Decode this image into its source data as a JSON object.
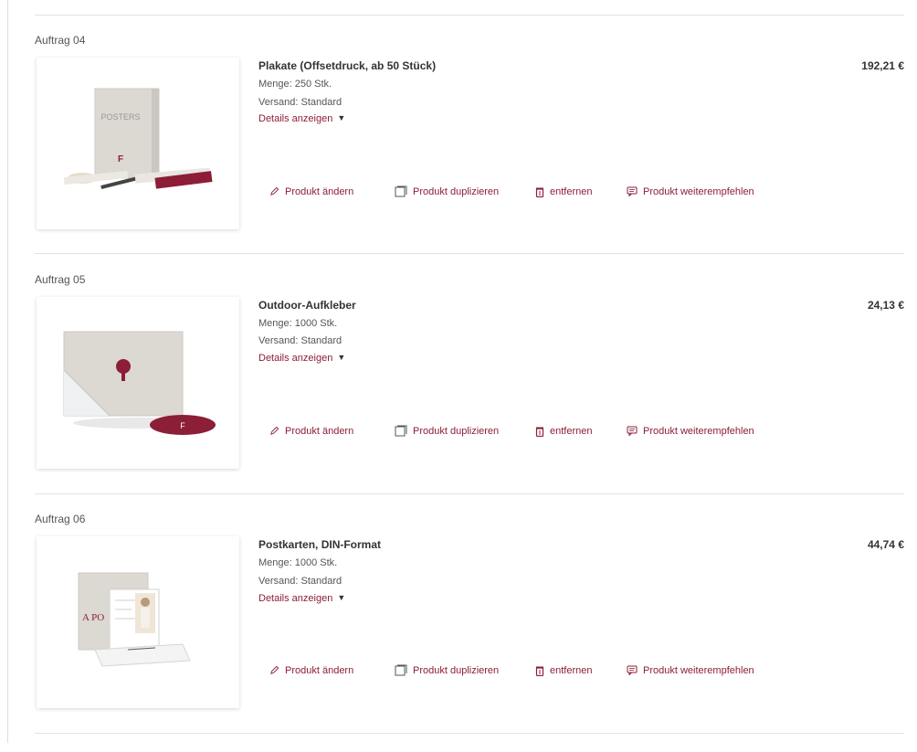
{
  "orders": [
    {
      "label": "Auftrag 04",
      "title": "Plakate (Offsetdruck, ab 50 Stück)",
      "quantity": "Menge: 250 Stk.",
      "shipping": "Versand: Standard",
      "details": "Details anzeigen",
      "price": "192,21 €",
      "image_text": "POSTERS",
      "image_icon": "poster-product-icon"
    },
    {
      "label": "Auftrag 05",
      "title": "Outdoor-Aufkleber",
      "quantity": "Menge: 1000 Stk.",
      "shipping": "Versand: Standard",
      "details": "Details anzeigen",
      "price": "24,13 €",
      "image_icon": "sticker-product-icon"
    },
    {
      "label": "Auftrag 06",
      "title": "Postkarten, DIN-Format",
      "quantity": "Menge: 1000 Stk.",
      "shipping": "Versand: Standard",
      "details": "Details anzeigen",
      "price": "44,74 €",
      "image_text": "A PO",
      "image_icon": "postcard-product-icon"
    }
  ],
  "actions": {
    "edit": "Produkt ändern",
    "duplicate": "Produkt duplizieren",
    "remove": "entfernen",
    "recommend": "Produkt weiterempfehlen"
  },
  "colors": {
    "accent": "#8c1e37",
    "divider": "#e2e2e2"
  }
}
